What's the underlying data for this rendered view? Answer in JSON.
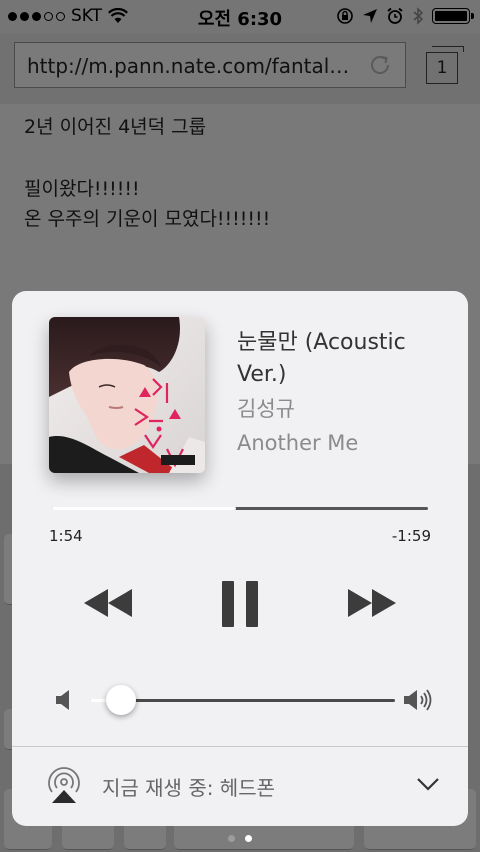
{
  "status_bar": {
    "carrier": "SKT",
    "time": "오전 6:30",
    "signal_bars_filled": 3,
    "signal_bars_total": 5,
    "battery_level": 1.0
  },
  "browser": {
    "url": "http://m.pann.nate.com/fantalk…",
    "tab_count": "1"
  },
  "page_content": {
    "cut_line": "2년 이어진 4년덕 그룹",
    "line1": "필이왔다!!!!!!",
    "line2": "온 우주의 기운이 모였다!!!!!!!"
  },
  "now_playing": {
    "title": "눈물만 (Acoustic Ver.)",
    "artist": "김성규",
    "album": "Another Me",
    "elapsed": "1:54",
    "remaining": "-1:59",
    "progress": 0.49,
    "volume": 0.1,
    "output_label": "지금 재생 중: 헤드폰"
  },
  "pager": {
    "count": 2,
    "active": 1
  },
  "icons": {
    "rewind": "rewind-icon",
    "pause": "pause-icon",
    "forward": "fast-forward-icon",
    "airplay": "airplay-icon",
    "chevron": "chevron-down-icon",
    "reload": "reload-icon"
  },
  "colors": {
    "panel_bg": "#f1f1f3",
    "control_glyph": "#3c3c3c",
    "secondary_text": "#8b8b8b"
  }
}
